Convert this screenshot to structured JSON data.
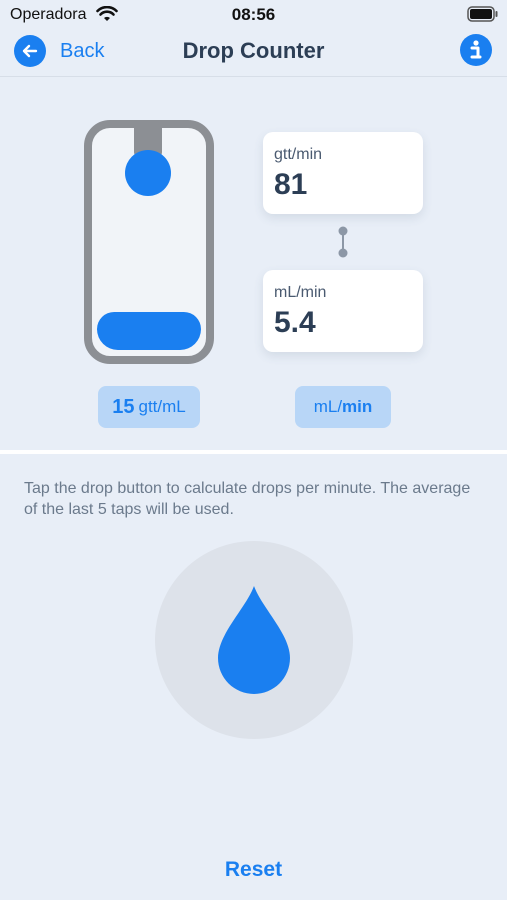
{
  "status_bar": {
    "carrier": "Operadora",
    "time": "08:56"
  },
  "nav": {
    "back_label": "Back",
    "title": "Drop Counter"
  },
  "cards": {
    "gtt": {
      "label": "gtt/min",
      "value": "81"
    },
    "ml": {
      "label": "mL/min",
      "value": "5.4"
    }
  },
  "units": {
    "drop_factor_value": "15",
    "drop_factor_unit": "gtt/mL",
    "rate_unit_prefix": "mL/",
    "rate_unit_suffix": "min"
  },
  "instructions": "Tap the drop button to calculate drops per minute. The average of the last 5 taps will be used.",
  "reset_label": "Reset",
  "colors": {
    "accent": "#1a7ff0",
    "background": "#e8eef7",
    "chamber": "#8c8f94"
  },
  "icons": [
    "wifi-icon",
    "battery-icon",
    "back-arrow-icon",
    "info-icon",
    "drop-icon"
  ]
}
